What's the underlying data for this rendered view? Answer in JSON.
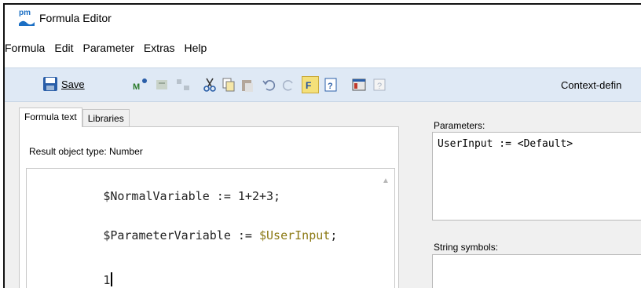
{
  "window": {
    "title": "Formula Editor",
    "logo_text": "pm"
  },
  "menu": [
    "Formula",
    "Edit",
    "Parameter",
    "Extras",
    "Help"
  ],
  "toolbar": {
    "save_label": "Save",
    "context_label": "Context-defin",
    "icons": [
      "save-icon",
      "macro-icon",
      "insert-icon",
      "grid-icon",
      "cut-icon",
      "copy-icon",
      "paste-icon",
      "undo-icon",
      "redo-icon",
      "format-icon",
      "help-book-icon",
      "dialog-icon",
      "info-icon"
    ]
  },
  "tabs": [
    {
      "label": "Formula text",
      "active": true
    },
    {
      "label": "Libraries",
      "active": false
    }
  ],
  "editor": {
    "result_type_label": "Result object type: Number",
    "lines": [
      {
        "prefix": "$NormalVariable := 1+2+3;",
        "var": ""
      },
      {
        "prefix": "$ParameterVariable := ",
        "var": "$UserInput",
        "suffix": ";"
      },
      {
        "prefix": "1",
        "var": ""
      }
    ]
  },
  "parameters": {
    "label": "Parameters:",
    "value": "UserInput := <Default>"
  },
  "string_symbols": {
    "label": "String symbols:"
  },
  "colors": {
    "toolbar_bg": "#dfe9f5",
    "variable_highlight": "#8c7a14",
    "brand": "#1b6fc4"
  }
}
